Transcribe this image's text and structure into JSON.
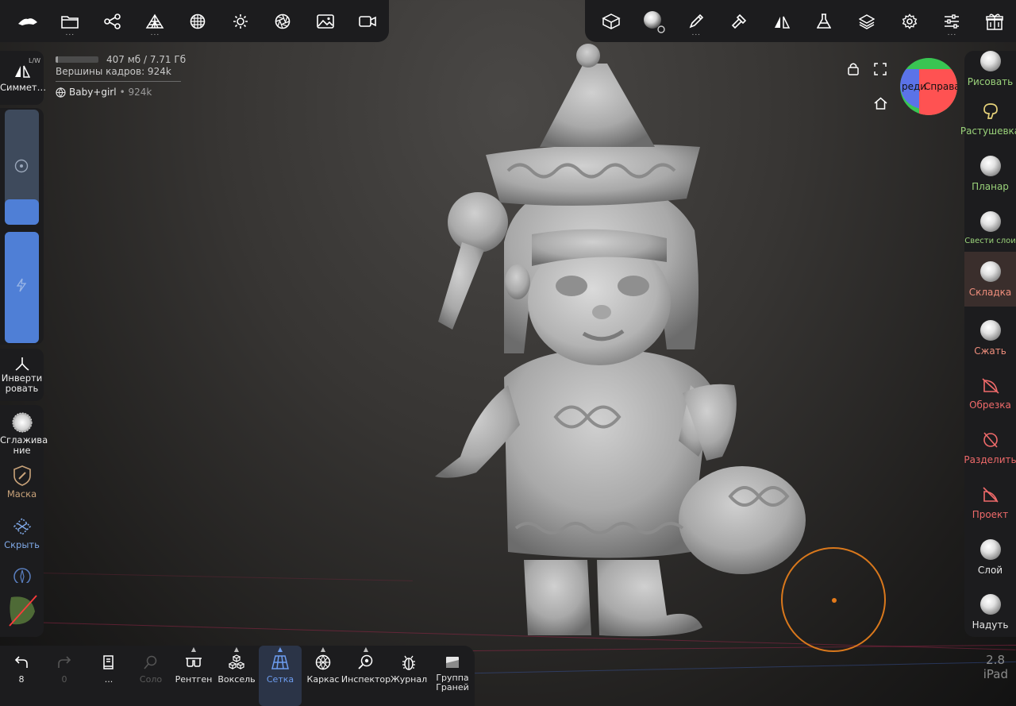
{
  "top_left_toolbar": {
    "buttons": [
      {
        "icon": "nomad-logo-icon",
        "has_menu": false
      },
      {
        "icon": "folder-icon",
        "has_menu": true
      },
      {
        "icon": "scene-graph-icon",
        "has_menu": false
      },
      {
        "icon": "primitives-icon",
        "has_menu": true
      },
      {
        "icon": "material-sphere-icon",
        "has_menu": false
      },
      {
        "icon": "light-sun-icon",
        "has_menu": false
      },
      {
        "icon": "aperture-icon",
        "has_menu": false
      },
      {
        "icon": "image-icon",
        "has_menu": false
      },
      {
        "icon": "video-camera-icon",
        "has_menu": false
      }
    ],
    "menu_dots": "..."
  },
  "top_right_toolbar": {
    "buttons": [
      {
        "icon": "cube-transform-icon",
        "has_menu": false
      },
      {
        "icon": "matcap-sphere-icon",
        "has_menu": false
      },
      {
        "icon": "brush-pen-icon",
        "has_menu": true
      },
      {
        "icon": "hammer-icon",
        "has_menu": false
      },
      {
        "icon": "symmetry-triangle-icon",
        "has_menu": false
      },
      {
        "icon": "flask-icon",
        "has_menu": false
      },
      {
        "icon": "layers-icon",
        "has_menu": false
      },
      {
        "icon": "gear-icon",
        "has_menu": false
      },
      {
        "icon": "sliders-icon",
        "has_menu": true
      },
      {
        "icon": "gift-icon",
        "has_menu": false
      }
    ],
    "menu_dots": "..."
  },
  "hud": {
    "memory_text": "407 мб / 7.71 Гб",
    "memory_fraction": 0.05,
    "frame_vertices": "Вершины кадров:  924k",
    "mesh_name": "Baby+girl",
    "mesh_count": "• 924k"
  },
  "left_toolbar": {
    "symmetry_label": "Симмет…",
    "lw_badge": "L/W",
    "radius_slider_value": 0.22,
    "intensity_slider_value": 1.0,
    "invert_label": "Инверти\nровать",
    "smooth_label": "Сглажива\nние",
    "mask_label": "Маска",
    "hide_label": "Скрыть"
  },
  "right_toolbar": {
    "tools": [
      {
        "label": "Рисовать",
        "color": "#9ad27a",
        "icon": "paint-sphere-icon"
      },
      {
        "label": "Растушевка",
        "color": "#9ad27a",
        "icon": "smudge-icon"
      },
      {
        "label": "Планар",
        "color": "#9ad27a",
        "icon": "planar-sphere-icon"
      },
      {
        "label": "Свести слои",
        "color": "#9ad27a",
        "icon": "flatten-sphere-icon"
      },
      {
        "label": "Складка",
        "color": "#ef8e7c",
        "icon": "crease-sphere-icon",
        "active": true
      },
      {
        "label": "Сжать",
        "color": "#ef8e7c",
        "icon": "pinch-sphere-icon"
      },
      {
        "label": "Обрезка",
        "color": "#ef6a6a",
        "icon": "trim-icon"
      },
      {
        "label": "Разделить",
        "color": "#ef6a6a",
        "icon": "split-icon"
      },
      {
        "label": "Проект",
        "color": "#ef6a6a",
        "icon": "project-icon"
      },
      {
        "label": "Слой",
        "color": "#e8e8e8",
        "icon": "layer-sphere-icon"
      },
      {
        "label": "Надуть",
        "color": "#e8e8e8",
        "icon": "inflate-sphere-icon"
      }
    ]
  },
  "bottom_toolbar": {
    "undo_count": "8",
    "redo_count": "0",
    "more_label": "...",
    "solo_label": "Соло",
    "xray_label": "Рентген",
    "voxel_label": "Воксель",
    "mesh_label": "Сетка",
    "wireframe_label": "Каркас",
    "inspector_label": "Инспектор",
    "history_label": "Журнал",
    "face_group_label": "Группа\nГраней"
  },
  "viewport": {
    "gizmo_front": "реди",
    "gizmo_right": "Справа",
    "accent_blue": "#4f7fd6",
    "brush_color": "#d9781c",
    "version": "2.8",
    "device": "iPad"
  }
}
